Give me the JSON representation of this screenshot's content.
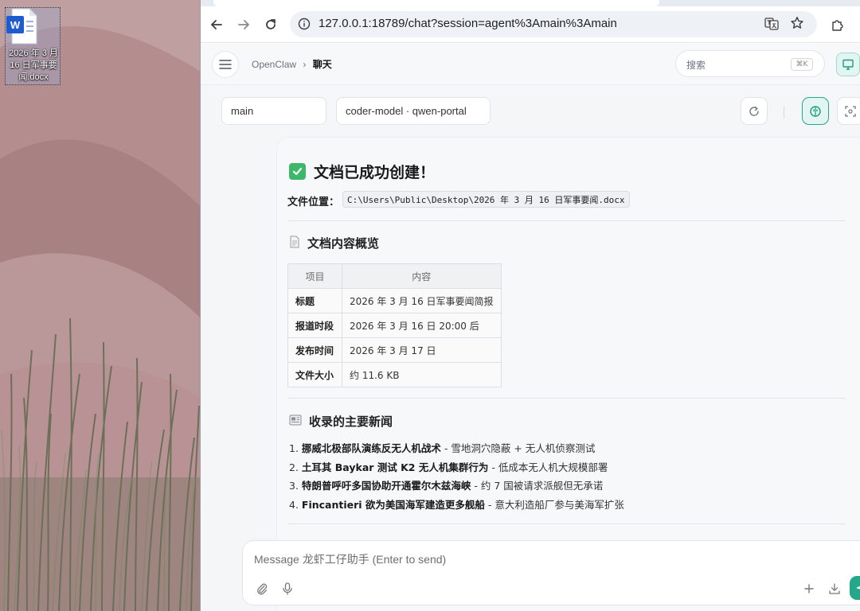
{
  "desktop": {
    "file_icon": {
      "glyph": "W",
      "label": "2026 年 3 月 16 日军事要闻.docx"
    }
  },
  "browser": {
    "url": "127.0.0.1:18789/chat?session=agent%3Amain%3Amain",
    "icons": [
      "back-icon",
      "forward-icon",
      "reload-icon",
      "info-icon",
      "translate-icon",
      "bookmark-star-icon",
      "extensions-icon"
    ]
  },
  "app": {
    "breadcrumb": {
      "root": "OpenClaw",
      "separator": "›",
      "current": "聊天"
    },
    "search": {
      "placeholder": "搜索",
      "shortcut": "⌘K"
    },
    "session_select": "main",
    "model_select": "coder-model · qwen-portal",
    "accent_color": "#24a889"
  },
  "message": {
    "title": "文档已成功创建！",
    "file_location_label": "文件位置：",
    "file_path": "C:\\Users\\Public\\Desktop\\2026 年 3 月 16 日军事要闻.docx",
    "overview_heading": "文档内容概览",
    "table": {
      "headers": [
        "项目",
        "内容"
      ],
      "rows": [
        {
          "key": "标题",
          "value": "2026 年 3 月 16 日军事要闻简报"
        },
        {
          "key": "报道时段",
          "value": "2026 年 3 月 16 日 20:00 后"
        },
        {
          "key": "发布时间",
          "value": "2026 年 3 月 17 日"
        },
        {
          "key": "文件大小",
          "value": "约 11.6 KB"
        }
      ]
    },
    "news_heading": "收录的主要新闻",
    "news": [
      {
        "num": "1.",
        "title": "挪威北极部队演练反无人机战术",
        "desc": " - 雪地洞穴隐蔽 + 无人机侦察测试"
      },
      {
        "num": "2.",
        "title": "土耳其 Baykar 测试 K2 无人机集群行为",
        "desc": " - 低成本无人机大规模部署"
      },
      {
        "num": "3.",
        "title": "特朗普呼吁多国协助开通霍尔木兹海峡",
        "desc": " - 约 7 国被请求派舰但无承诺"
      },
      {
        "num": "4.",
        "title": "Fincantieri 欲为美国海军建造更多舰船",
        "desc": " - 意大利造船厂参与美海军扩张"
      }
    ]
  },
  "composer": {
    "placeholder": "Message 龙虾工仔助手 (Enter to send)"
  }
}
